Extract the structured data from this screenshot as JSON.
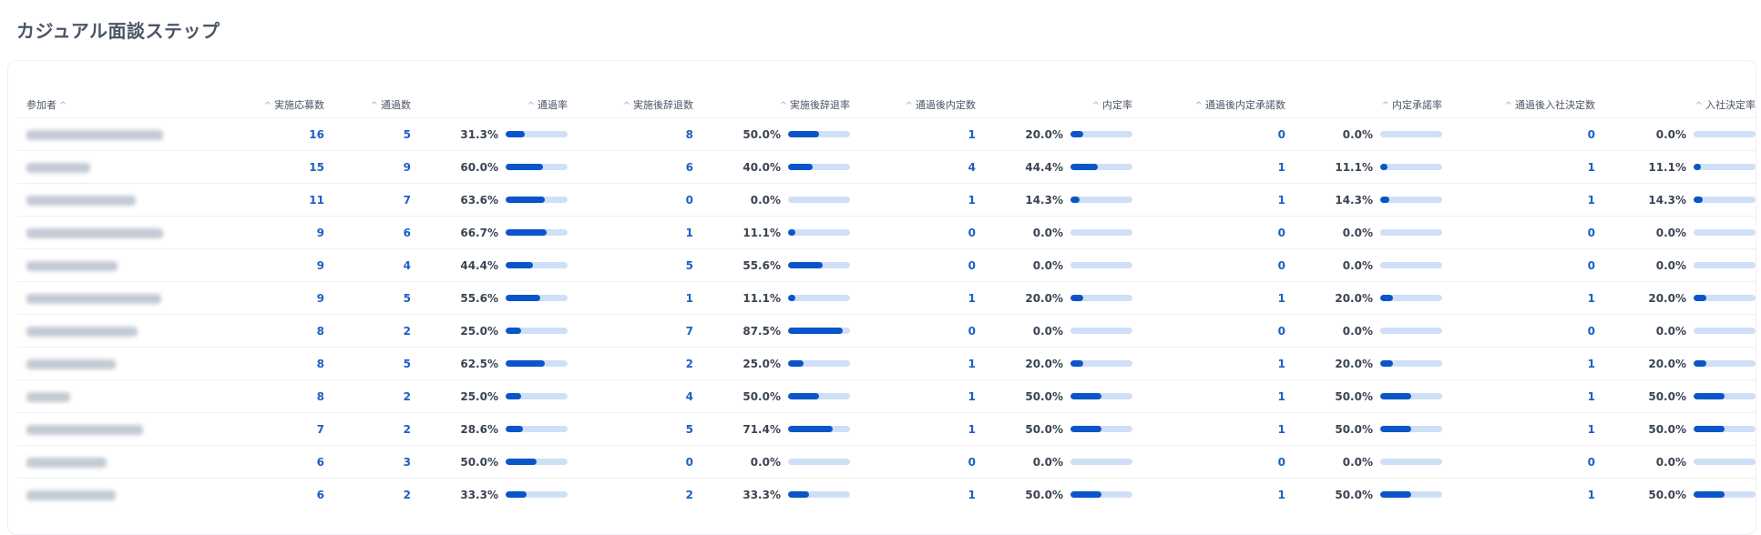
{
  "page_title": "カジュアル面談ステップ",
  "sort_icon": "chevron-up-icon",
  "columns": {
    "participant": "参加者",
    "applications": "実施応募数",
    "passed": "通過数",
    "pass_rate": "通過率",
    "post_decline": "実施後辞退数",
    "post_decline_rate": "実施後辞退率",
    "post_offer": "通過後内定数",
    "offer_rate": "内定率",
    "post_accept": "通過後内定承諾数",
    "accept_rate": "内定承諾率",
    "post_join": "通過後入社決定数",
    "join_rate": "入社決定率"
  },
  "rows": [
    {
      "applications": "16",
      "passed": "5",
      "pass_rate": "31.3%",
      "post_decline": "8",
      "post_decline_rate": "50.0%",
      "post_offer": "1",
      "offer_rate": "20.0%",
      "post_accept": "0",
      "accept_rate": "0.0%",
      "post_join": "0",
      "join_rate": "0.0%"
    },
    {
      "applications": "15",
      "passed": "9",
      "pass_rate": "60.0%",
      "post_decline": "6",
      "post_decline_rate": "40.0%",
      "post_offer": "4",
      "offer_rate": "44.4%",
      "post_accept": "1",
      "accept_rate": "11.1%",
      "post_join": "1",
      "join_rate": "11.1%"
    },
    {
      "applications": "11",
      "passed": "7",
      "pass_rate": "63.6%",
      "post_decline": "0",
      "post_decline_rate": "0.0%",
      "post_offer": "1",
      "offer_rate": "14.3%",
      "post_accept": "1",
      "accept_rate": "14.3%",
      "post_join": "1",
      "join_rate": "14.3%"
    },
    {
      "applications": "9",
      "passed": "6",
      "pass_rate": "66.7%",
      "post_decline": "1",
      "post_decline_rate": "11.1%",
      "post_offer": "0",
      "offer_rate": "0.0%",
      "post_accept": "0",
      "accept_rate": "0.0%",
      "post_join": "0",
      "join_rate": "0.0%"
    },
    {
      "applications": "9",
      "passed": "4",
      "pass_rate": "44.4%",
      "post_decline": "5",
      "post_decline_rate": "55.6%",
      "post_offer": "0",
      "offer_rate": "0.0%",
      "post_accept": "0",
      "accept_rate": "0.0%",
      "post_join": "0",
      "join_rate": "0.0%"
    },
    {
      "applications": "9",
      "passed": "5",
      "pass_rate": "55.6%",
      "post_decline": "1",
      "post_decline_rate": "11.1%",
      "post_offer": "1",
      "offer_rate": "20.0%",
      "post_accept": "1",
      "accept_rate": "20.0%",
      "post_join": "1",
      "join_rate": "20.0%"
    },
    {
      "applications": "8",
      "passed": "2",
      "pass_rate": "25.0%",
      "post_decline": "7",
      "post_decline_rate": "87.5%",
      "post_offer": "0",
      "offer_rate": "0.0%",
      "post_accept": "0",
      "accept_rate": "0.0%",
      "post_join": "0",
      "join_rate": "0.0%"
    },
    {
      "applications": "8",
      "passed": "5",
      "pass_rate": "62.5%",
      "post_decline": "2",
      "post_decline_rate": "25.0%",
      "post_offer": "1",
      "offer_rate": "20.0%",
      "post_accept": "1",
      "accept_rate": "20.0%",
      "post_join": "1",
      "join_rate": "20.0%"
    },
    {
      "applications": "8",
      "passed": "2",
      "pass_rate": "25.0%",
      "post_decline": "4",
      "post_decline_rate": "50.0%",
      "post_offer": "1",
      "offer_rate": "50.0%",
      "post_accept": "1",
      "accept_rate": "50.0%",
      "post_join": "1",
      "join_rate": "50.0%"
    },
    {
      "applications": "7",
      "passed": "2",
      "pass_rate": "28.6%",
      "post_decline": "5",
      "post_decline_rate": "71.4%",
      "post_offer": "1",
      "offer_rate": "50.0%",
      "post_accept": "1",
      "accept_rate": "50.0%",
      "post_join": "1",
      "join_rate": "50.0%"
    },
    {
      "applications": "6",
      "passed": "3",
      "pass_rate": "50.0%",
      "post_decline": "0",
      "post_decline_rate": "0.0%",
      "post_offer": "0",
      "offer_rate": "0.0%",
      "post_accept": "0",
      "accept_rate": "0.0%",
      "post_join": "0",
      "join_rate": "0.0%"
    },
    {
      "applications": "6",
      "passed": "2",
      "pass_rate": "33.3%",
      "post_decline": "2",
      "post_decline_rate": "33.3%",
      "post_offer": "1",
      "offer_rate": "50.0%",
      "post_accept": "1",
      "accept_rate": "50.0%",
      "post_join": "1",
      "join_rate": "50.0%"
    }
  ],
  "colors": {
    "accent": "#0a55c9",
    "bar_track": "#cfe0f6",
    "link_number": "#1c5fc4"
  }
}
